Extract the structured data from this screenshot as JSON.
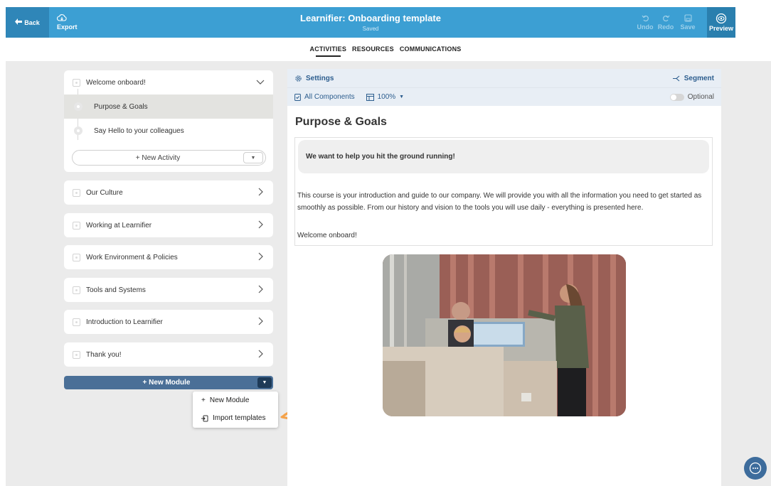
{
  "topbar": {
    "back_label": "Back",
    "export_label": "Export",
    "title": "Learnifier: Onboarding template",
    "status": "Saved",
    "undo_label": "Undo",
    "redo_label": "Redo",
    "save_label": "Save",
    "preview_label": "Preview"
  },
  "tabs": [
    {
      "label": "ACTIVITIES",
      "active": true
    },
    {
      "label": "RESOURCES",
      "active": false
    },
    {
      "label": "COMMUNICATIONS",
      "active": false
    }
  ],
  "modules": {
    "expanded": {
      "title": "Welcome onboard!",
      "activities": [
        "Purpose & Goals",
        "Say Hello to your colleagues"
      ],
      "new_activity_label": "+ New Activity"
    },
    "collapsed": [
      "Our Culture",
      "Working at Learnifier",
      "Work Environment & Policies",
      "Tools and Systems",
      "Introduction to Learnifier",
      "Thank you!"
    ],
    "new_module_label": "+ New Module",
    "dropdown": {
      "new_module": "New Module",
      "import_templates": "Import templates"
    }
  },
  "editor": {
    "settings_label": "Settings",
    "segment_label": "Segment",
    "all_components_label": "All Components",
    "zoom_label": "100%",
    "optional_label": "Optional",
    "page_title": "Purpose & Goals",
    "callout": "We want to help you hit the ground running!",
    "paragraph": "This course is your introduction and guide to our company. We will provide you with all the information you need to get started as smoothly as possible. From our history and vision to the tools you will use daily - everything is presented here.",
    "closing": "Welcome onboard!"
  },
  "colors": {
    "topbar": "#3c9fd3",
    "new_module_button": "#4a6f97",
    "annotation_arrow": "#f4a24a",
    "accent_text": "#2c5d8e"
  }
}
